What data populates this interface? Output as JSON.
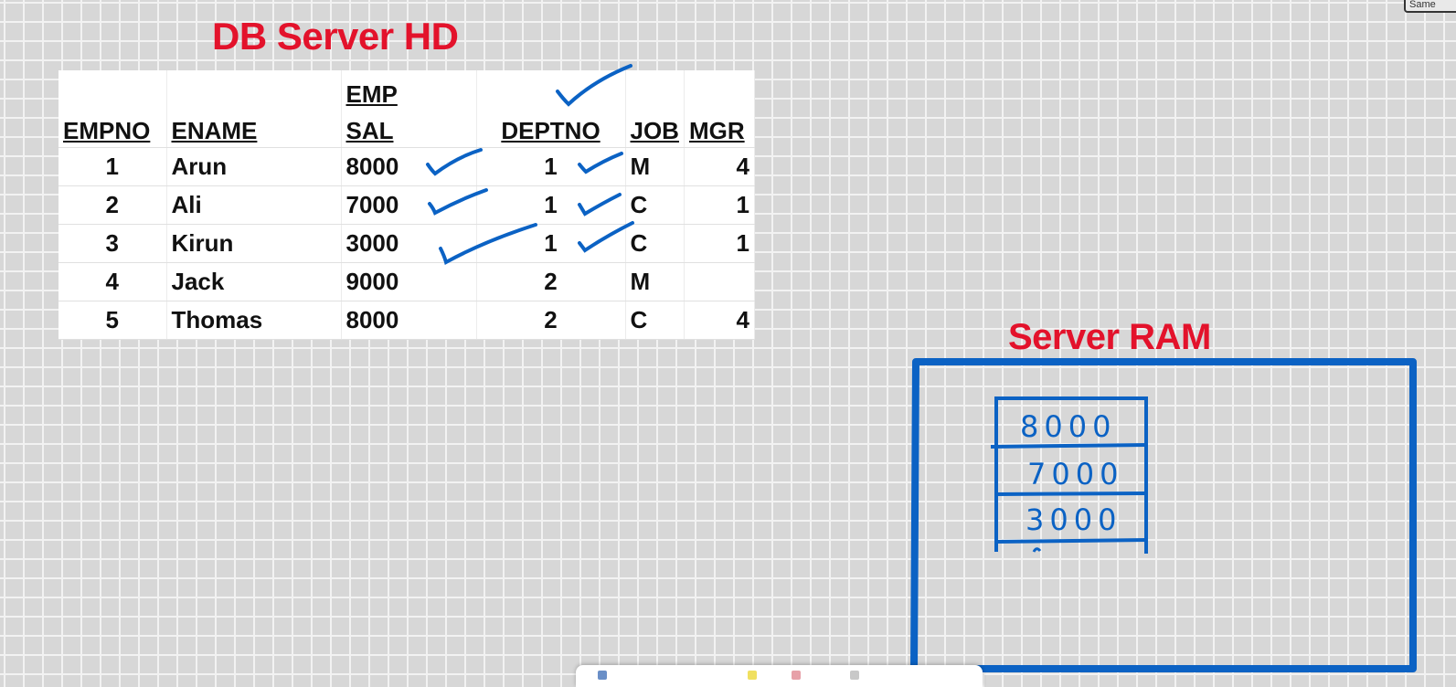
{
  "db_title": "DB Server HD",
  "ram_title": "Server RAM",
  "corner_tab_label": "Same",
  "table": {
    "top_row": [
      "",
      "",
      "EMP",
      "",
      "",
      ""
    ],
    "headers": [
      "EMPNO",
      "ENAME",
      "SAL",
      "DEPTNO",
      "JOB",
      "MGR"
    ],
    "rows": [
      [
        "1",
        "Arun",
        "8000",
        "1",
        "M",
        "4"
      ],
      [
        "2",
        "Ali",
        "7000",
        "1",
        "C",
        "1"
      ],
      [
        "3",
        "Kirun",
        "3000",
        "1",
        "C",
        "1"
      ],
      [
        "4",
        "Jack",
        "9000",
        "2",
        "M",
        ""
      ],
      [
        "5",
        "Thomas",
        "8000",
        "2",
        "C",
        "4"
      ]
    ]
  },
  "ram_values": [
    "8000",
    "7000",
    "3000"
  ],
  "ink_color": "#0b62c4",
  "title_color": "#e3122b"
}
